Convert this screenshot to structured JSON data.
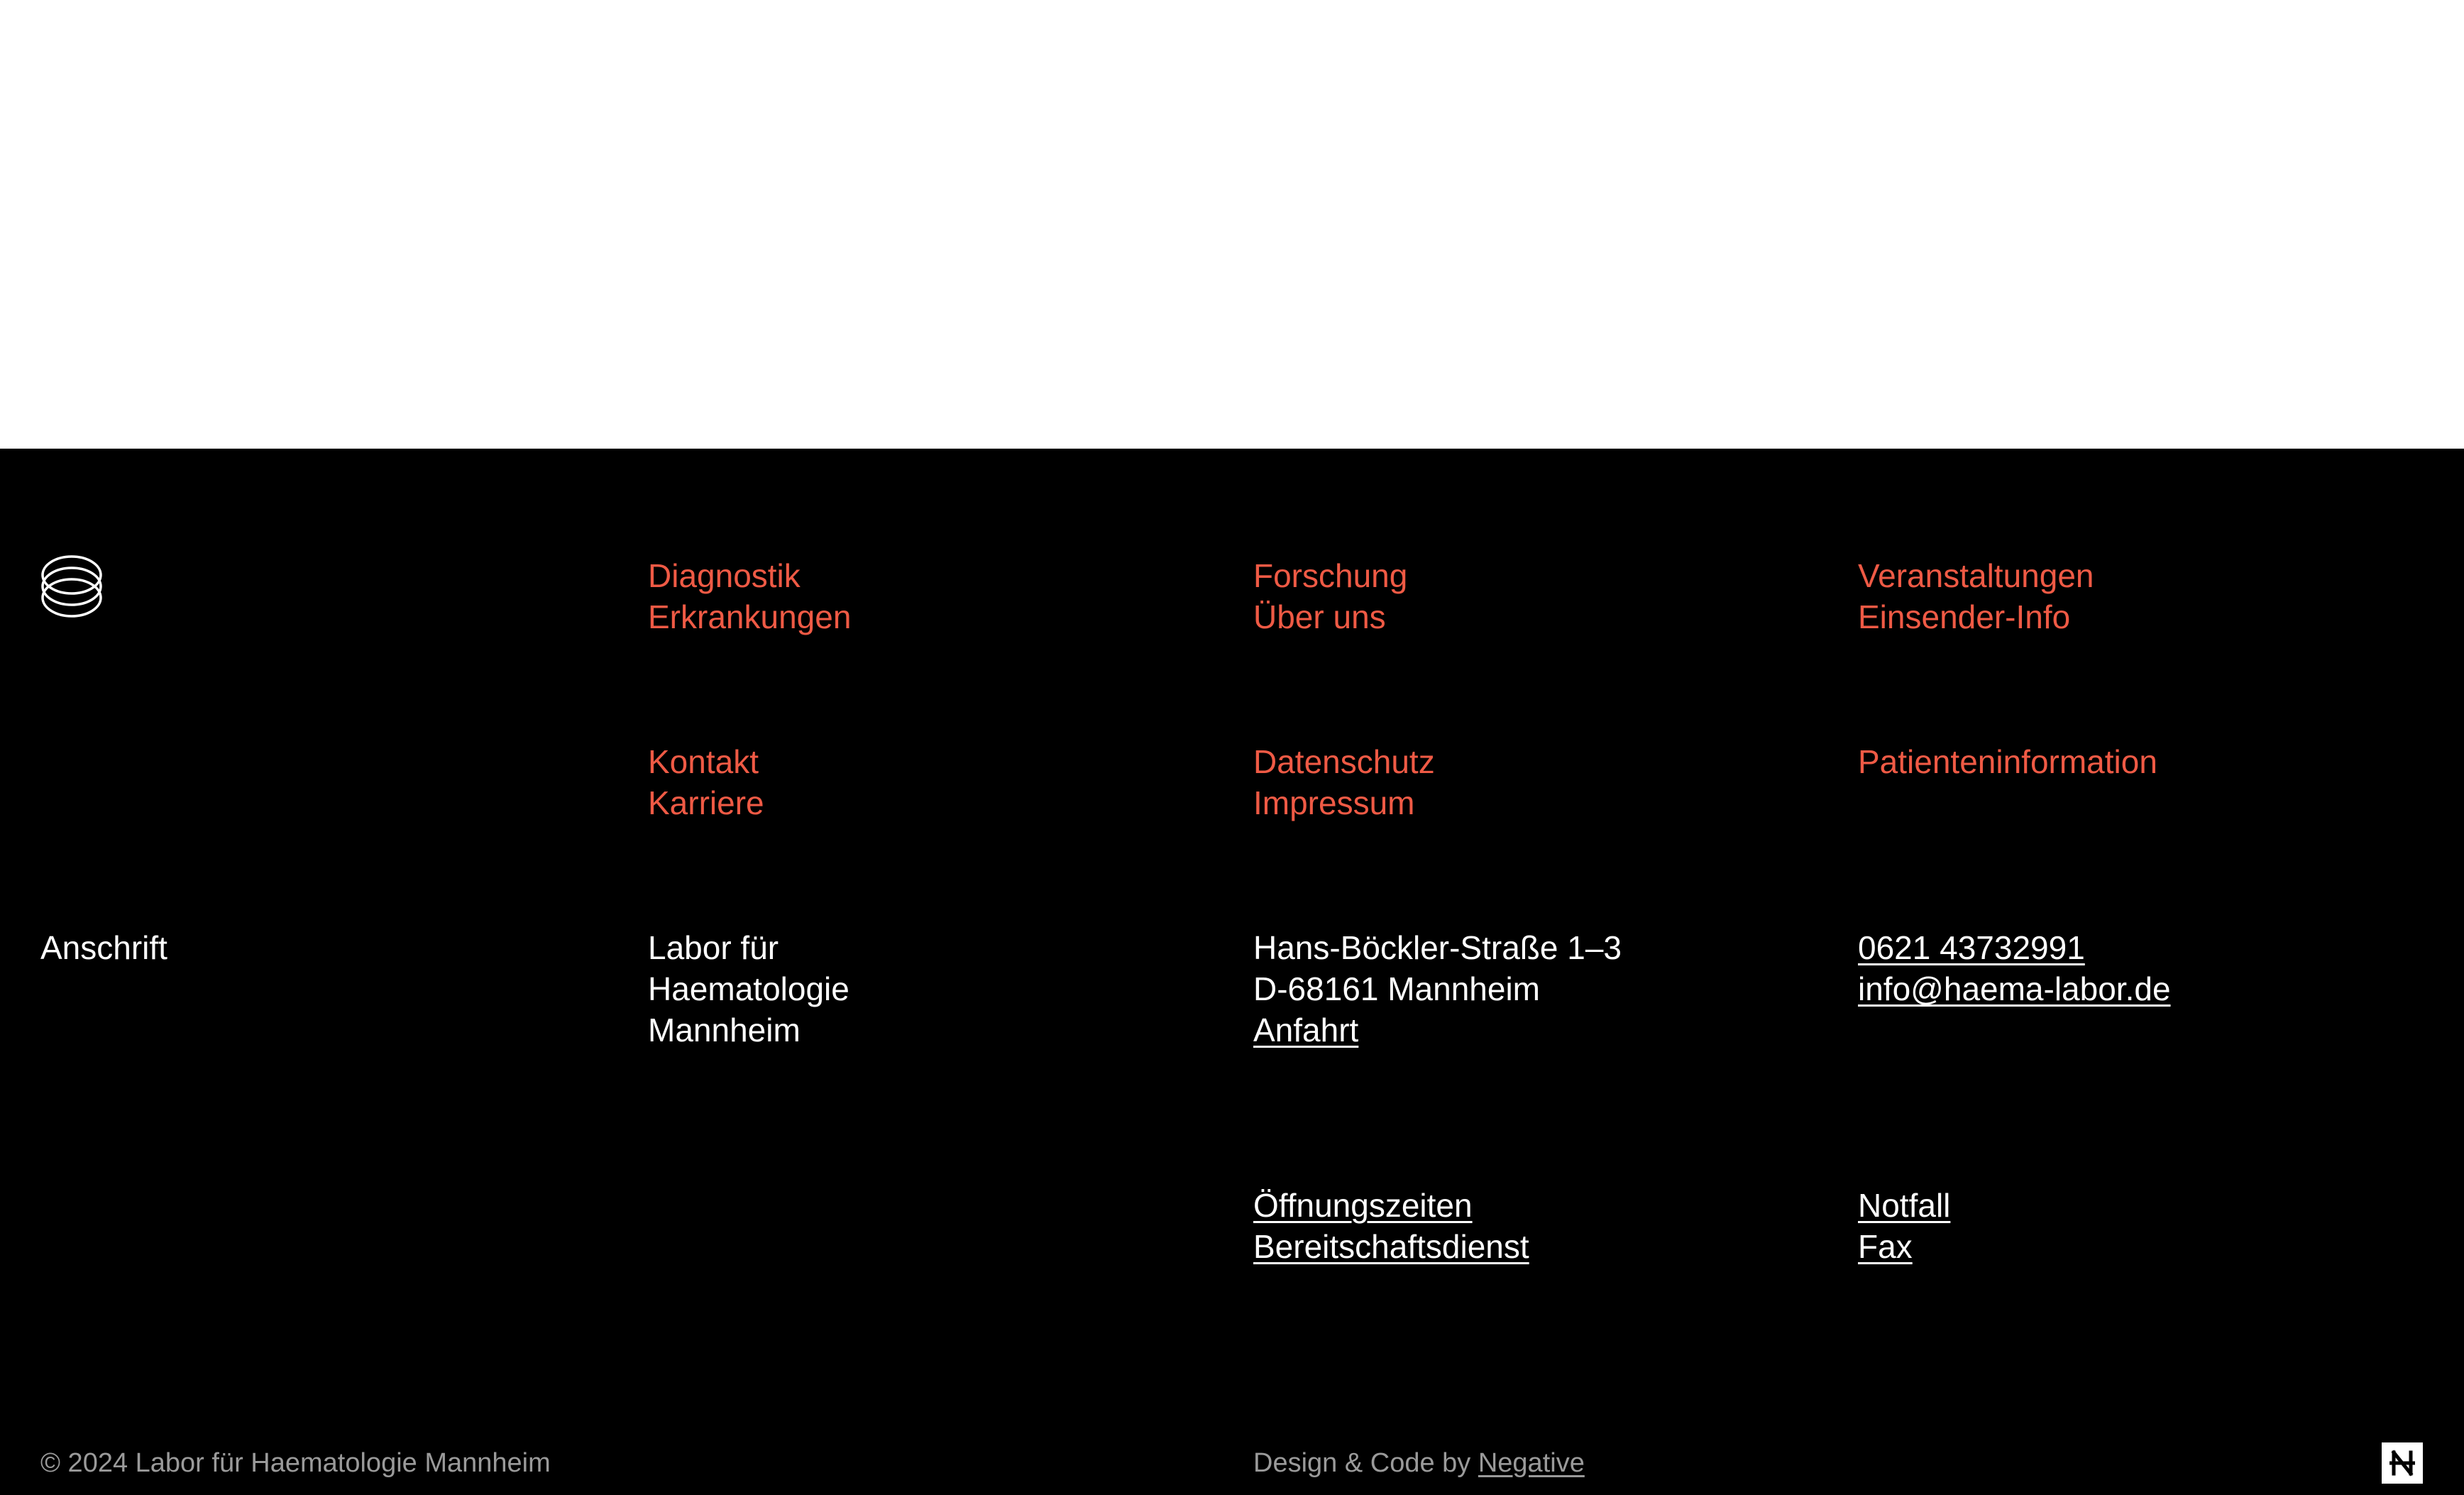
{
  "colors": {
    "footer_bg": "#000000",
    "nav_link": "#ef5a45",
    "text": "#ffffff",
    "muted": "#9a9a9a"
  },
  "logo": {
    "icon": "stacked-rings-logo-icon"
  },
  "nav": {
    "col1_group1": [
      "Diagnostik",
      "Erkrankungen"
    ],
    "col2_group1": [
      "Forschung",
      "Über uns"
    ],
    "col3_group1": [
      "Veranstaltungen",
      "Einsender-Info"
    ],
    "col1_group2": [
      "Kontakt",
      "Karriere"
    ],
    "col2_group2": [
      "Datenschutz",
      "Impressum"
    ],
    "col3_group2": [
      "Patienteninformation"
    ]
  },
  "address": {
    "heading": "Anschrift",
    "name_lines": [
      "Labor für",
      "Haematologie",
      "Mannheim"
    ],
    "street": "Hans-Böckler-Straße 1–3",
    "city": "D-68161 Mannheim",
    "directions_link": "Anfahrt",
    "phone": "0621 43732991",
    "email": "info@haema-labor.de"
  },
  "service_links": {
    "col2": [
      "Öffnungszeiten",
      "Bereitschaftsdienst"
    ],
    "col3": [
      "Notfall",
      "Fax"
    ]
  },
  "bottom": {
    "copyright": "© 2024 Labor für Haematologie Mannheim",
    "credit_prefix": "Design & Code by ",
    "credit_link": "Negative",
    "badge_icon": "negative-logo-icon"
  }
}
